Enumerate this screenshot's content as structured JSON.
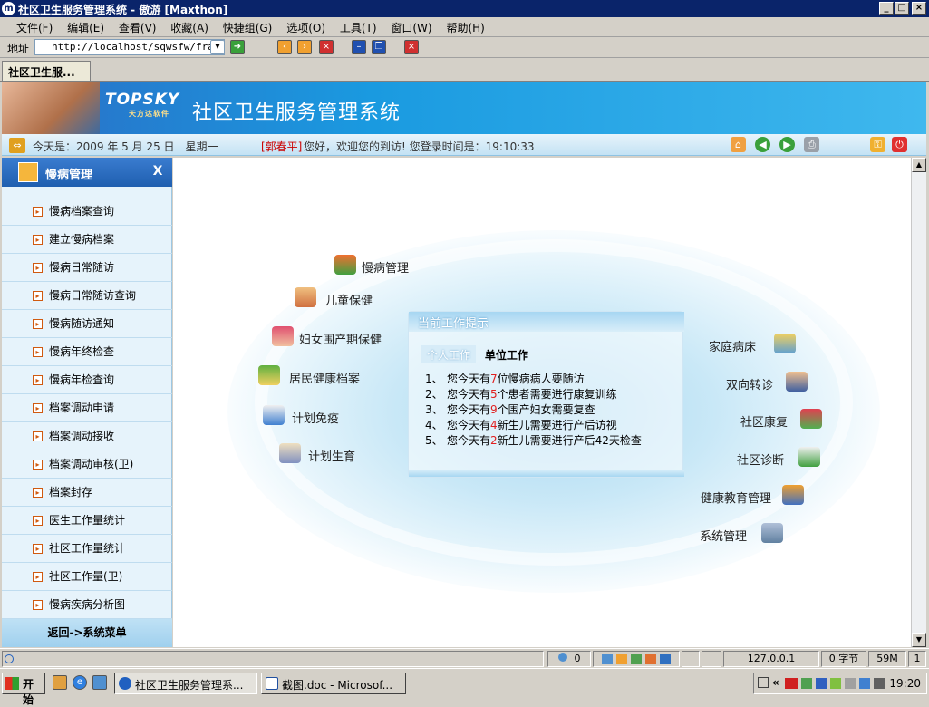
{
  "window": {
    "title": "社区卫生服务管理系统 - 傲游 [Maxthon]",
    "min": "_",
    "max": "□",
    "close": "×"
  },
  "menu": [
    "文件(F)",
    "编辑(E)",
    "查看(V)",
    "收藏(A)",
    "快捷组(G)",
    "选项(O)",
    "工具(T)",
    "窗口(W)",
    "帮助(H)"
  ],
  "address": {
    "label": "地址",
    "url": "http://localhost/sqwsfw/frame"
  },
  "tab": {
    "label": "社区卫生服..."
  },
  "banner": {
    "logo": "TOPSKY",
    "logo_sub": "天方达软件",
    "system_name": "社区卫生服务管理系统"
  },
  "info": {
    "date": "今天是：2009 年 5 月 25 日　星期一",
    "user": "[郭春平]",
    "welcome": "您好，欢迎您的到访! 您登录时间是：19:10:33"
  },
  "sidebar": {
    "title": "慢病管理",
    "close": "X",
    "items": [
      "慢病档案查询",
      "建立慢病档案",
      "慢病日常随访",
      "慢病日常随访查询",
      "慢病随访通知",
      "慢病年终检查",
      "慢病年检查询",
      "档案调动申请",
      "档案调动接收",
      "档案调动审核(卫)",
      "档案封存",
      "医生工作量统计",
      "社区工作量统计",
      "社区工作量(卫)",
      "慢病疾病分析图"
    ],
    "back": "返回->系统菜单"
  },
  "modules_left": [
    "慢病管理",
    "儿童保健",
    "妇女围产期保健",
    "居民健康档案",
    "计划免疫",
    "计划生育"
  ],
  "modules_right": [
    "家庭病床",
    "双向转诊",
    "社区康复",
    "社区诊断",
    "健康教育管理",
    "系统管理"
  ],
  "panel": {
    "title": "当前工作提示",
    "tab_personal": "个人工作",
    "tab_unit": "单位工作",
    "tasks": [
      {
        "no": "1、",
        "pre": "您今天有",
        "num": "7",
        "post": "位慢病病人要随访"
      },
      {
        "no": "2、",
        "pre": "您今天有",
        "num": "5",
        "post": "个患者需要进行康复训练"
      },
      {
        "no": "3、",
        "pre": "您今天有",
        "num": "9",
        "post": "个围产妇女需要复查"
      },
      {
        "no": "4、",
        "pre": "您今天有",
        "num": "4",
        "post": "新生儿需要进行产后访视"
      },
      {
        "no": "5、",
        "pre": "您今天有",
        "num": "2",
        "post": "新生儿需要进行产后42天检查"
      }
    ]
  },
  "status": {
    "count": "0",
    "ip": "127.0.0.1",
    "bytes": "0 字节",
    "mem": "59M",
    "n": "1"
  },
  "taskbar": {
    "start": "开始",
    "tasks": [
      "社区卫生服务管理系...",
      "截图.doc - Microsof..."
    ],
    "clock": "19:20"
  }
}
